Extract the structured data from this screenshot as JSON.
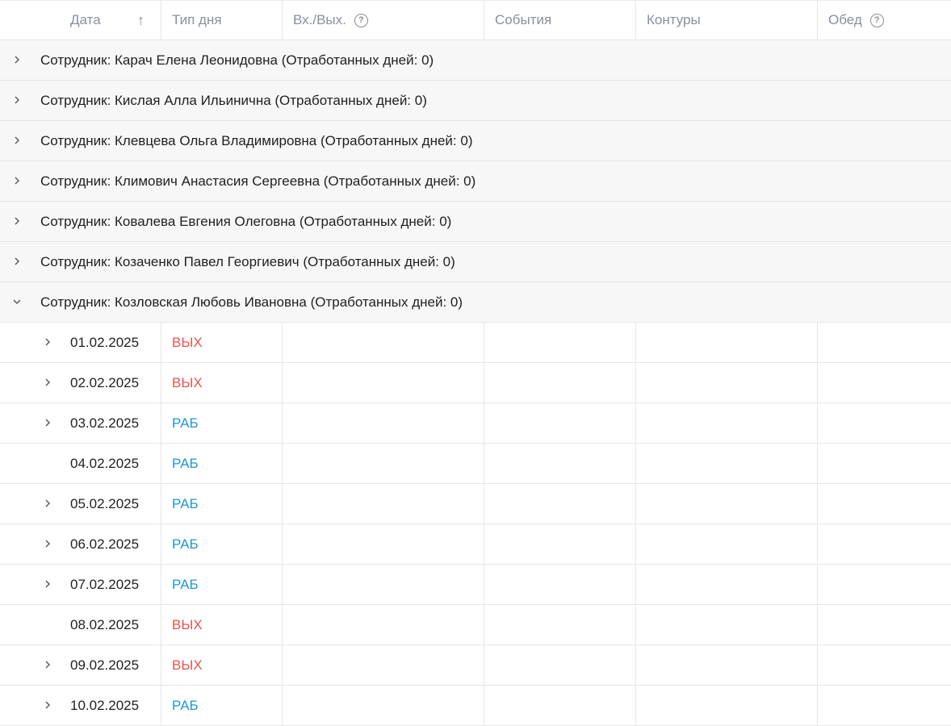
{
  "columns": {
    "date": "Дата",
    "day_type": "Тип дня",
    "in_out": "Вх./Вых.",
    "events": "События",
    "contours": "Контуры",
    "lunch": "Обед"
  },
  "sort_icon": "arrow-up-icon",
  "help_glyph": "?",
  "groups": [
    "Сотрудник: Карач Елена Леонидовна (Отработанных дней: 0)",
    "Сотрудник: Кислая Алла Ильинична (Отработанных дней: 0)",
    "Сотрудник: Клевцева Ольга Владимировна (Отработанных дней: 0)",
    "Сотрудник: Климович Анастасия Сергеевна (Отработанных дней: 0)",
    "Сотрудник: Ковалева Евгения Олеговна (Отработанных дней: 0)",
    "Сотрудник: Козаченко Павел Георгиевич (Отработанных дней: 0)",
    "Сотрудник: Козловская Любовь Ивановна (Отработанных дней: 0)"
  ],
  "days": [
    {
      "date": "01.02.2025",
      "type": "ВЫХ"
    },
    {
      "date": "02.02.2025",
      "type": "ВЫХ"
    },
    {
      "date": "03.02.2025",
      "type": "РАБ"
    },
    {
      "date": "04.02.2025",
      "type": "РАБ"
    },
    {
      "date": "05.02.2025",
      "type": "РАБ"
    },
    {
      "date": "06.02.2025",
      "type": "РАБ"
    },
    {
      "date": "07.02.2025",
      "type": "РАБ"
    },
    {
      "date": "08.02.2025",
      "type": "ВЫХ"
    },
    {
      "date": "09.02.2025",
      "type": "ВЫХ"
    },
    {
      "date": "10.02.2025",
      "type": "РАБ"
    }
  ],
  "colors": {
    "weekend": "#e8534e",
    "workday": "#1e96d2"
  }
}
